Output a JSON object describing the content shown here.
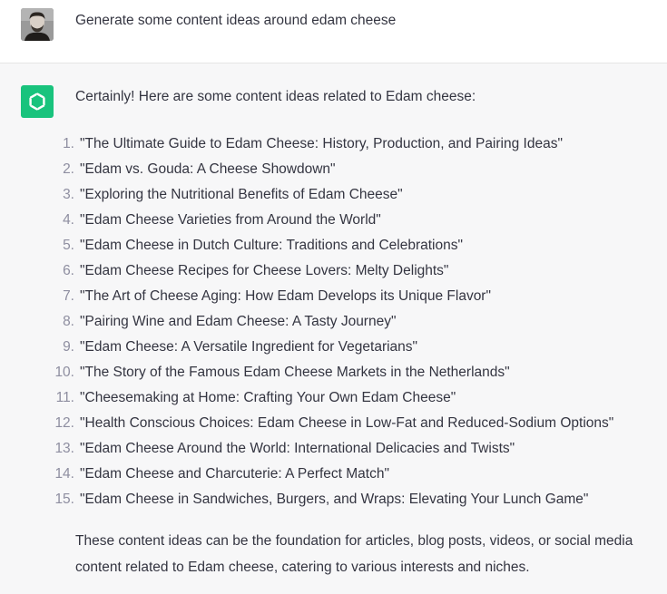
{
  "user_message": {
    "text": "Generate some content ideas around edam cheese"
  },
  "assistant_message": {
    "intro": "Certainly! Here are some content ideas related to Edam cheese:",
    "ideas": [
      {
        "number": "1.",
        "text": "\"The Ultimate Guide to Edam Cheese: History, Production, and Pairing Ideas\""
      },
      {
        "number": "2.",
        "text": "\"Edam vs. Gouda: A Cheese Showdown\""
      },
      {
        "number": "3.",
        "text": "\"Exploring the Nutritional Benefits of Edam Cheese\""
      },
      {
        "number": "4.",
        "text": "\"Edam Cheese Varieties from Around the World\""
      },
      {
        "number": "5.",
        "text": "\"Edam Cheese in Dutch Culture: Traditions and Celebrations\""
      },
      {
        "number": "6.",
        "text": "\"Edam Cheese Recipes for Cheese Lovers: Melty Delights\""
      },
      {
        "number": "7.",
        "text": "\"The Art of Cheese Aging: How Edam Develops its Unique Flavor\""
      },
      {
        "number": "8.",
        "text": "\"Pairing Wine and Edam Cheese: A Tasty Journey\""
      },
      {
        "number": "9.",
        "text": "\"Edam Cheese: A Versatile Ingredient for Vegetarians\""
      },
      {
        "number": "10.",
        "text": "\"The Story of the Famous Edam Cheese Markets in the Netherlands\""
      },
      {
        "number": "11.",
        "text": "\"Cheesemaking at Home: Crafting Your Own Edam Cheese\""
      },
      {
        "number": "12.",
        "text": "\"Health Conscious Choices: Edam Cheese in Low-Fat and Reduced-Sodium Options\""
      },
      {
        "number": "13.",
        "text": "\"Edam Cheese Around the World: International Delicacies and Twists\""
      },
      {
        "number": "14.",
        "text": "\"Edam Cheese and Charcuterie: A Perfect Match\""
      },
      {
        "number": "15.",
        "text": "\"Edam Cheese in Sandwiches, Burgers, and Wraps: Elevating Your Lunch Game\""
      }
    ],
    "outro": "These content ideas can be the foundation for articles, blog posts, videos, or social media content related to Edam cheese, catering to various interests and niches."
  },
  "icons": {
    "user": "user-avatar-photo",
    "assistant": "openai-logo-icon"
  },
  "colors": {
    "user_row_bg": "#ffffff",
    "assistant_row_bg": "#f7f7f8",
    "assistant_icon_bg": "#19c37d",
    "text": "#343541",
    "list_number": "#8e8ea0"
  }
}
